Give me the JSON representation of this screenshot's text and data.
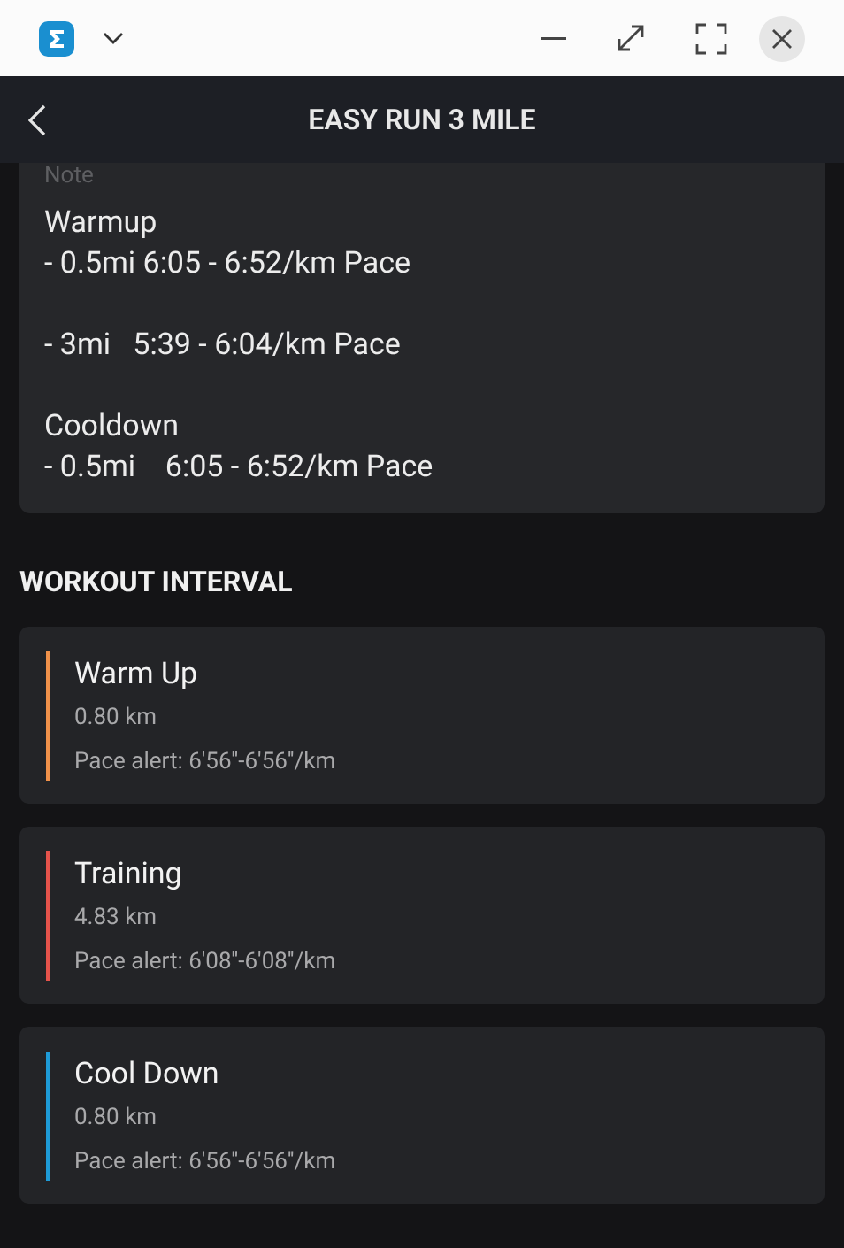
{
  "header": {
    "title": "EASY RUN 3 MILE"
  },
  "note": {
    "label": "Note",
    "text": "Warmup\n- 0.5mi 6:05 - 6:52/km Pace\n\n- 3mi   5:39 - 6:04/km Pace\n\nCooldown\n- 0.5mi    6:05 - 6:52/km Pace"
  },
  "section_title": "WORKOUT INTERVAL",
  "intervals": [
    {
      "name": "Warm Up",
      "distance": "0.80 km",
      "pace_alert": "Pace alert: 6'56''-6'56''/km",
      "color": "#f0914a"
    },
    {
      "name": "Training",
      "distance": "4.83 km",
      "pace_alert": "Pace alert: 6'08''-6'08''/km",
      "color": "#e5534b"
    },
    {
      "name": "Cool Down",
      "distance": "0.80 km",
      "pace_alert": "Pace alert: 6'56''-6'56''/km",
      "color": "#1e9bd7"
    }
  ]
}
